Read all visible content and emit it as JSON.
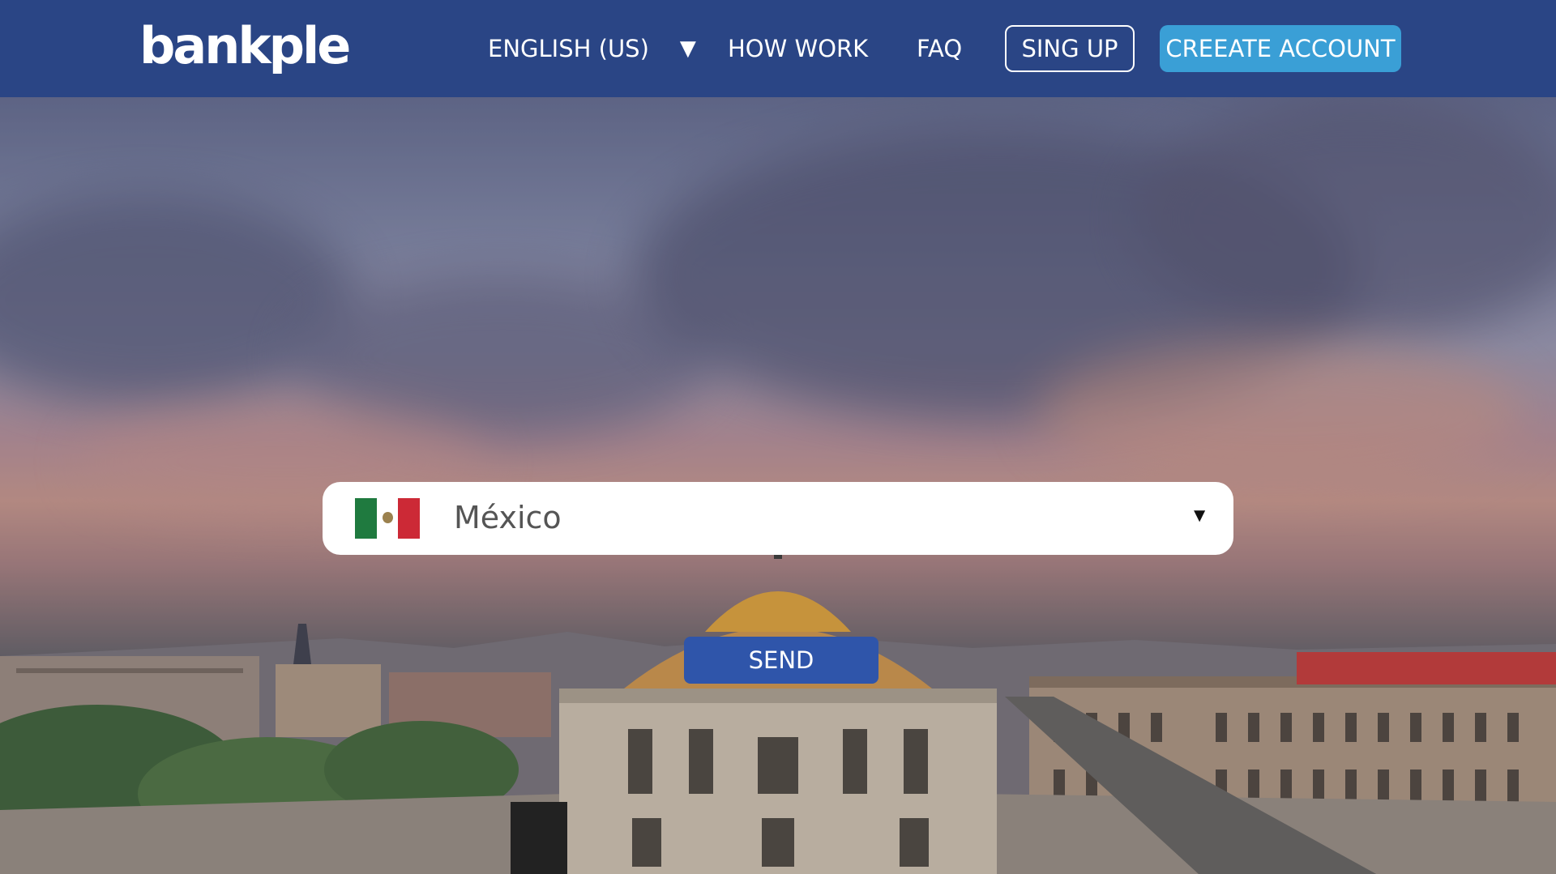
{
  "brand": {
    "logo_text": "bankple"
  },
  "nav": {
    "language": {
      "label": "ENGLISH (US)",
      "caret": "▼"
    },
    "how_work": "HOW WORK",
    "faq": "FAQ",
    "sign_up": "SING UP",
    "create_account": "CREEATE ACCOUNT"
  },
  "hero": {
    "country_select": {
      "selected_value": "México",
      "flag_icon": "mexico-flag-icon",
      "caret": "▼"
    },
    "send_label": "SEND"
  },
  "colors": {
    "navbar": "#2a4585",
    "create_button": "#3a9fd6",
    "send_button": "#2f55aa"
  }
}
